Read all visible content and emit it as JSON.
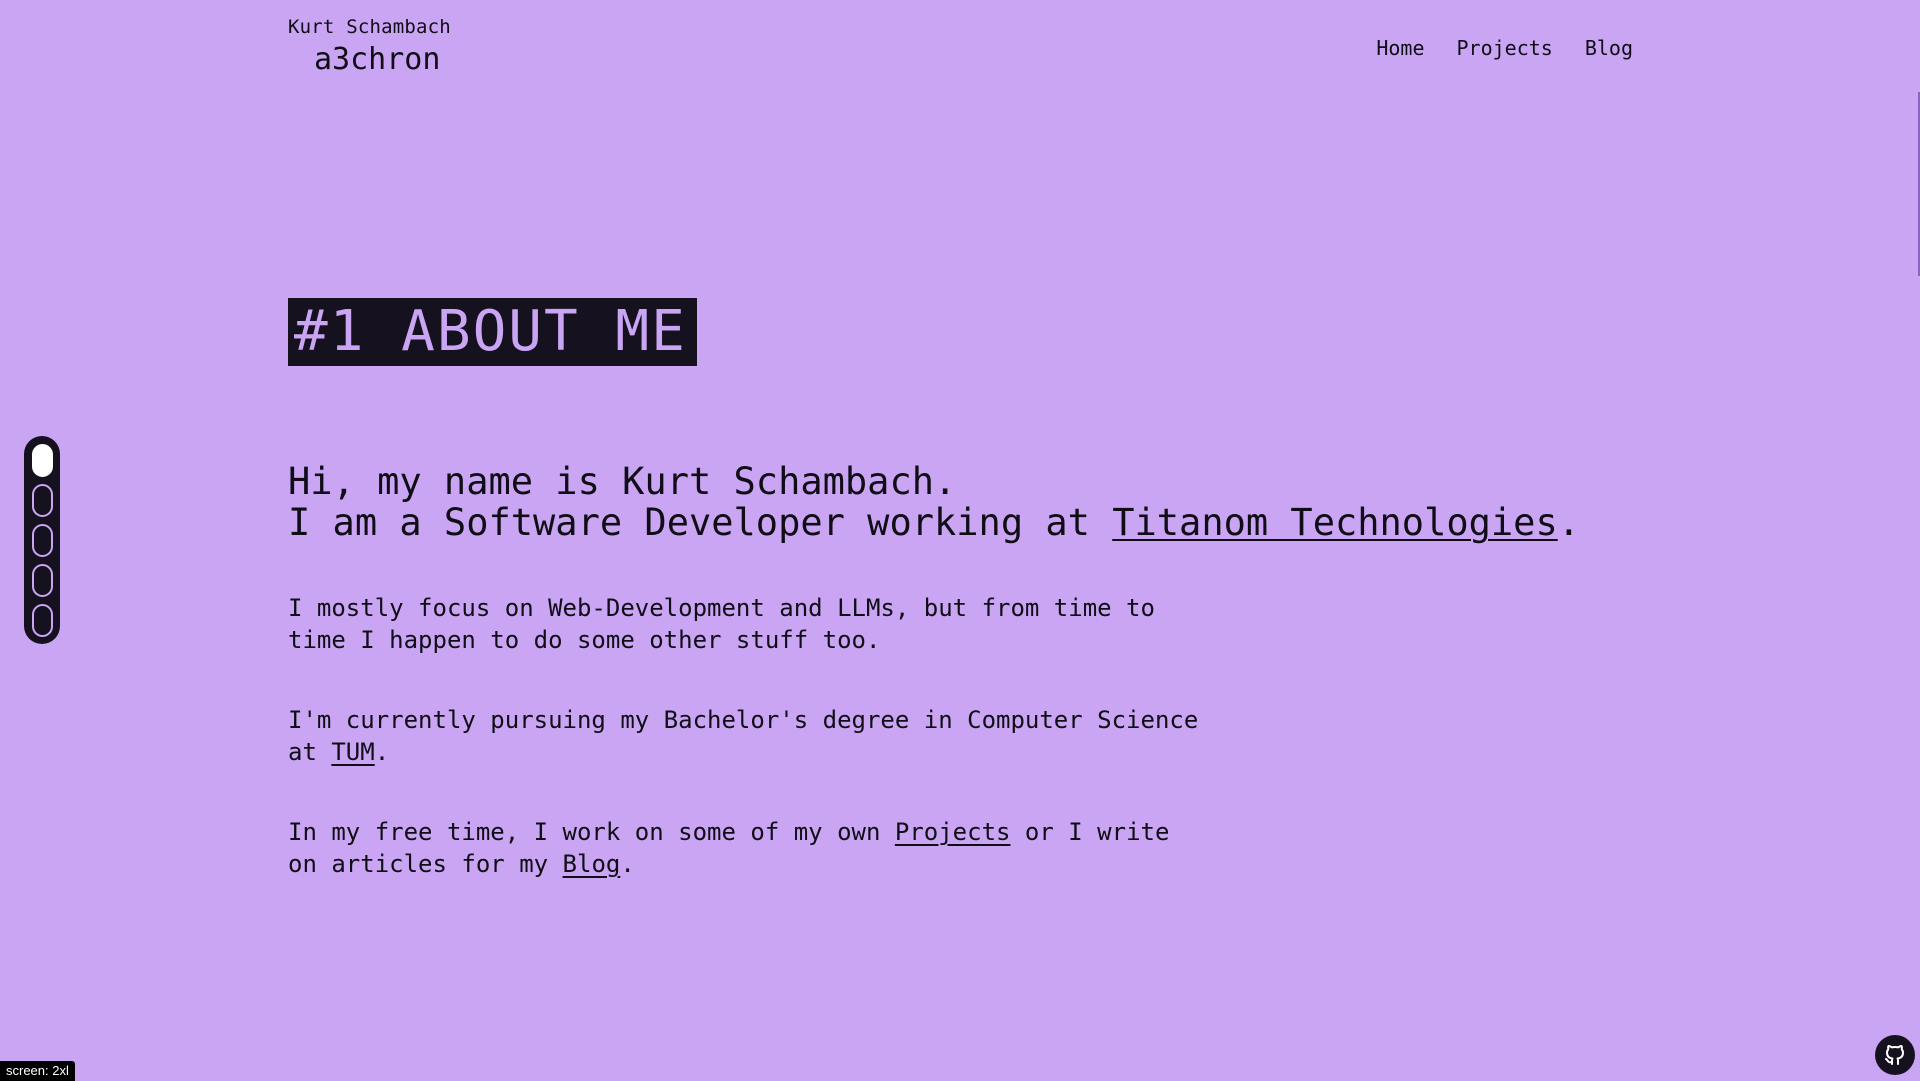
{
  "brand": {
    "name": "Kurt Schambach",
    "handle": "a3chron"
  },
  "nav": {
    "items": [
      {
        "label": "Home"
      },
      {
        "label": "Projects"
      },
      {
        "label": "Blog"
      }
    ]
  },
  "section": {
    "heading": "#1 ABOUT ME"
  },
  "intro": {
    "line1": "Hi, my name is Kurt Schambach.",
    "line2_prefix": "I am a Software Developer working at ",
    "line2_link": "Titanom Technologies",
    "line2_suffix": "."
  },
  "paragraphs": {
    "focus": "I mostly focus on Web-Development and LLMs, but from time to time I happen to do some other stuff too.",
    "study_prefix": "I'm currently pursuing my Bachelor's degree in Computer Science at ",
    "study_link": "TUM",
    "study_suffix": ".",
    "free_prefix": "In my free time, I work on some of my own ",
    "free_link1": "Projects",
    "free_middle": " or I write on articles for my ",
    "free_link2": "Blog",
    "free_suffix": "."
  },
  "section_nav": {
    "count": 5,
    "active_index": 0
  },
  "badge": {
    "text": "screen: 2xl"
  },
  "icons": {
    "github": "github-icon"
  },
  "colors": {
    "background": "#c9a5f3",
    "foreground": "#100d17",
    "dark": "#15111e"
  }
}
